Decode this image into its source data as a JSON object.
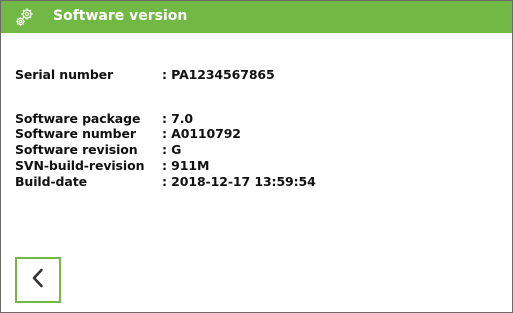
{
  "header": {
    "title": "Software version",
    "icon": "gear-icon",
    "background_color": "#72b844"
  },
  "info": {
    "rows": [
      {
        "label": "Serial number",
        "value": ": PA1234567865"
      },
      {
        "label": "Software package",
        "value": ": 7.0"
      },
      {
        "label": "Software number",
        "value": ": A0110792"
      },
      {
        "label": "Software revision",
        "value": ": G"
      },
      {
        "label": "SVN-build-revision",
        "value": ": 911M"
      },
      {
        "label": "Build-date",
        "value": ": 2018-12-17 13:59:54"
      }
    ]
  },
  "footer": {
    "back_icon": "chevron-left-icon",
    "border_color": "#72b844"
  }
}
